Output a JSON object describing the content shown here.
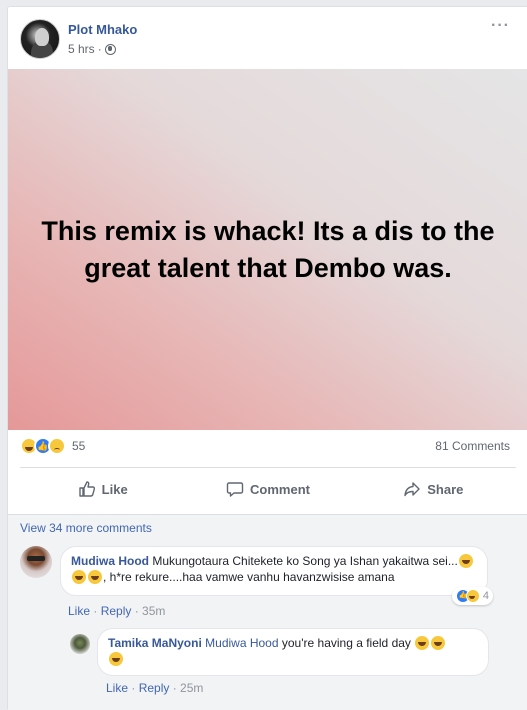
{
  "post": {
    "author": "Plot Mhako",
    "time": "5 hrs",
    "separator": "·",
    "more": "···",
    "banner_text": "This remix is whack! Its a dis to the great talent that Dembo was."
  },
  "reactions": {
    "count": "55",
    "comments": "81 Comments",
    "icons": [
      "haha-icon",
      "like-icon",
      "sad-icon"
    ]
  },
  "actions": {
    "like": "Like",
    "comment": "Comment",
    "share": "Share"
  },
  "comments": {
    "view_more": "View 34 more comments",
    "items": [
      {
        "name": "Mudiwa Hood",
        "text_a": "Mukungotaura Chitekete ko Song ya Ishan yakaitwa sei...",
        "text_b": ", h*re rekure....haa vamwe vanhu havanzwisise amana",
        "reaction_count": "4",
        "like": "Like",
        "reply": "Reply",
        "time": "35m",
        "dot": " · "
      },
      {
        "name": "Tamika MaNyoni",
        "mention": "Mudiwa Hood",
        "text": "you're having a field day",
        "like": "Like",
        "reply": "Reply",
        "time": "25m",
        "dot": " · "
      }
    ]
  },
  "colors": {
    "link": "#365899",
    "action_text": "#606770",
    "background": "#e9ebee"
  }
}
